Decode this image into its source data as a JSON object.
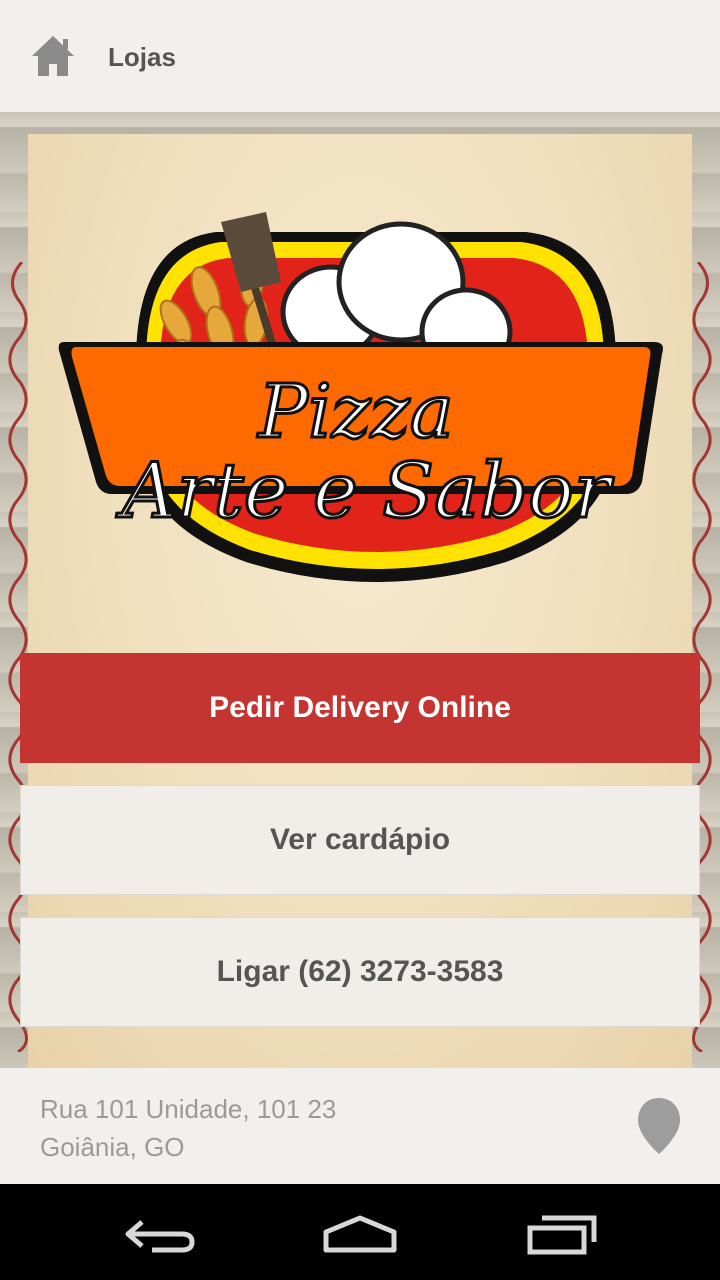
{
  "topbar": {
    "title": "Lojas",
    "home_icon": "home-icon"
  },
  "logo": {
    "line1": "Pizza",
    "line2": "Arte e Sabor"
  },
  "buttons": {
    "delivery": "Pedir Delivery Online",
    "menu": "Ver cardápio",
    "call": "Ligar (62) 3273-3583"
  },
  "footer": {
    "address_line1": "Rua 101 Unidade, 101 23",
    "address_line2": "Goiânia, GO",
    "pin_icon": "map-pin-icon"
  },
  "navbar": {
    "back_icon": "back-icon",
    "home_icon": "nav-home-icon",
    "recent_icon": "recent-apps-icon"
  },
  "colors": {
    "accent_red": "#c43431",
    "logo_orange": "#ff6a00",
    "logo_red": "#e2231a",
    "logo_yellow": "#ffe200"
  }
}
